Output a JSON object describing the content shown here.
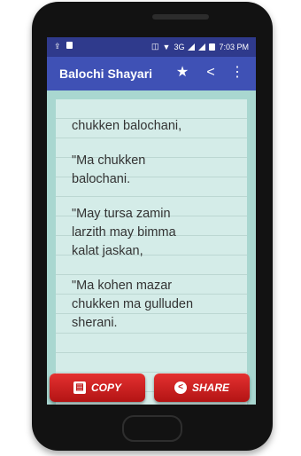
{
  "statusbar": {
    "network": "3G",
    "time": "7:03 PM"
  },
  "appbar": {
    "title": "Balochi Shayari",
    "star_icon": "★",
    "share_icon": "<",
    "menu_icon": "⋮"
  },
  "poem": {
    "lines": [
      "chukken balochani,",
      "\"Ma chukken\nbalochani.",
      "\"May tursa zamin\nlarzith may bimma\nkalat jaskan,",
      "\"Ma kohen mazar\nchukken ma gulluden\nsherani."
    ]
  },
  "buttons": {
    "copy_label": "COPY",
    "share_label": "SHARE"
  }
}
